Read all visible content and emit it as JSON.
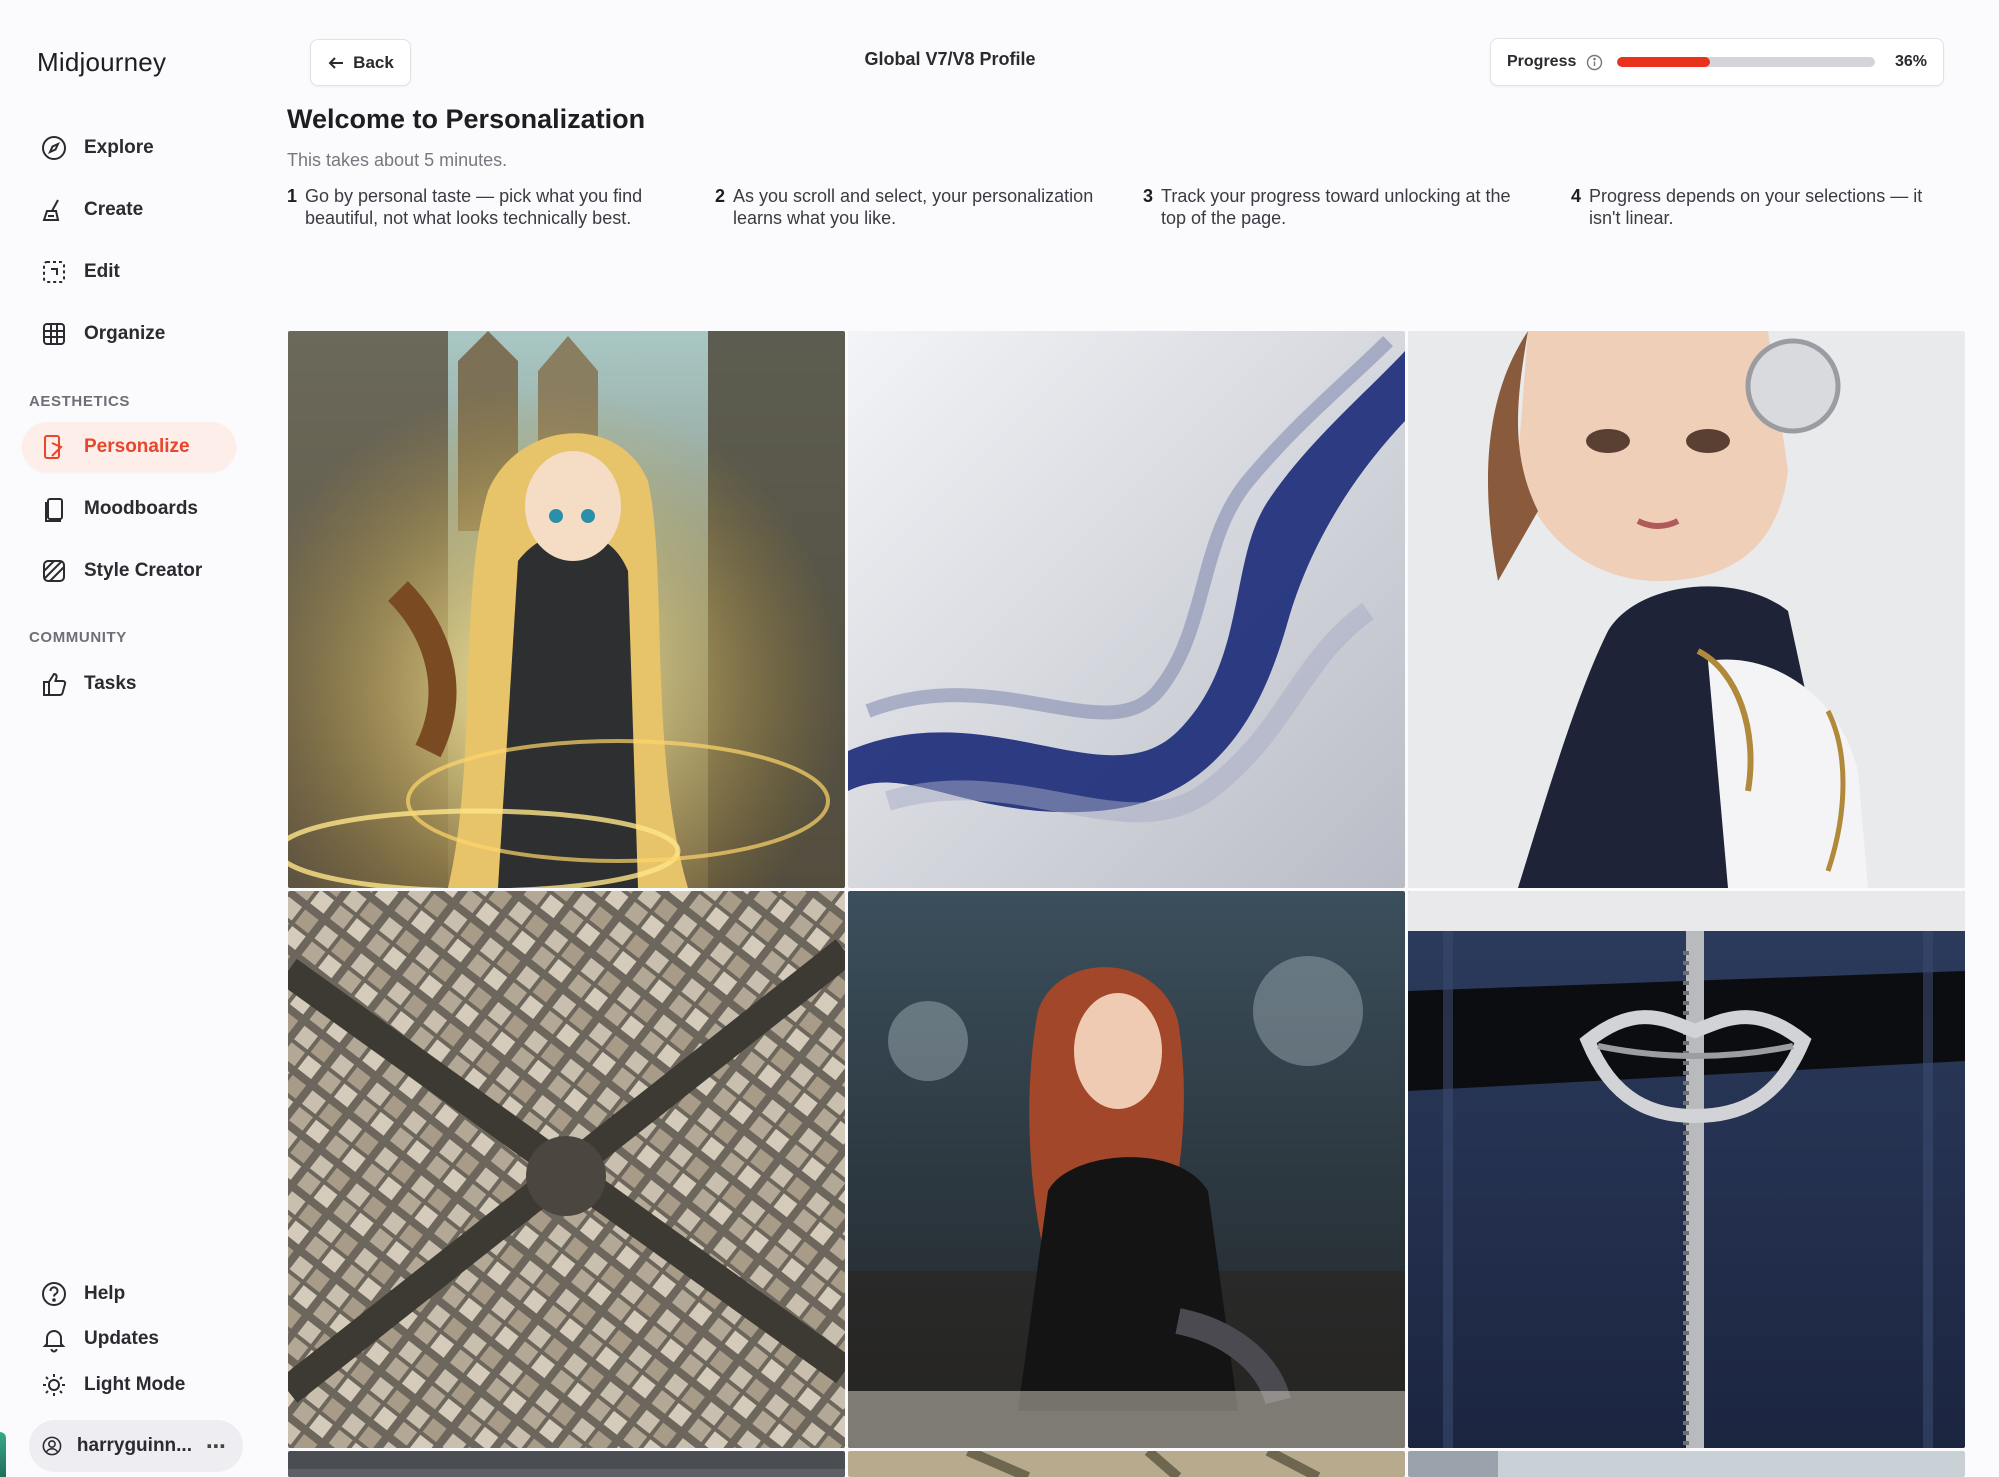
{
  "sidebar": {
    "brand": "Midjourney",
    "main_items": [
      {
        "label": "Explore",
        "icon": "compass-icon"
      },
      {
        "label": "Create",
        "icon": "brush-icon"
      },
      {
        "label": "Edit",
        "icon": "edit-icon"
      },
      {
        "label": "Organize",
        "icon": "grid-icon"
      }
    ],
    "aesthetics_label": "AESTHETICS",
    "aesthetics_items": [
      {
        "label": "Personalize",
        "icon": "personalize-icon",
        "active": true
      },
      {
        "label": "Moodboards",
        "icon": "moodboard-icon"
      },
      {
        "label": "Style Creator",
        "icon": "style-icon"
      }
    ],
    "community_label": "COMMUNITY",
    "community_items": [
      {
        "label": "Tasks",
        "icon": "thumbs-up-icon"
      }
    ],
    "footer_items": [
      {
        "label": "Help",
        "icon": "help-icon"
      },
      {
        "label": "Updates",
        "icon": "bell-icon"
      },
      {
        "label": "Light Mode",
        "icon": "sun-icon"
      }
    ],
    "user": {
      "name": "harryguinn...",
      "more": "⋯"
    }
  },
  "topbar": {
    "back_label": "Back",
    "profile_title": "Global V7/V8 Profile",
    "progress_label": "Progress",
    "progress_value": "36%",
    "progress_fraction": 0.36
  },
  "intro": {
    "title": "Welcome to Personalization",
    "subtitle": "This takes about 5 minutes.",
    "steps": [
      {
        "num": "1",
        "text": "Go by personal taste — pick what you find beautiful, not what looks technically best."
      },
      {
        "num": "2",
        "text": "As you scroll and select, your personalization learns what you like."
      },
      {
        "num": "3",
        "text": "Track your progress toward unlocking at the top of the page."
      },
      {
        "num": "4",
        "text": "Progress depends on your selections — it isn't linear."
      }
    ]
  },
  "colors": {
    "accent": "#e8452b",
    "active_bg": "#fdeeea",
    "progress_fill": "#e8321c"
  },
  "gallery": [
    "anime-violinist-image",
    "blue-wave-abstract-image",
    "android-girl-image",
    "aerial-city-image",
    "redhead-woman-image",
    "denim-lips-buckle-image"
  ]
}
